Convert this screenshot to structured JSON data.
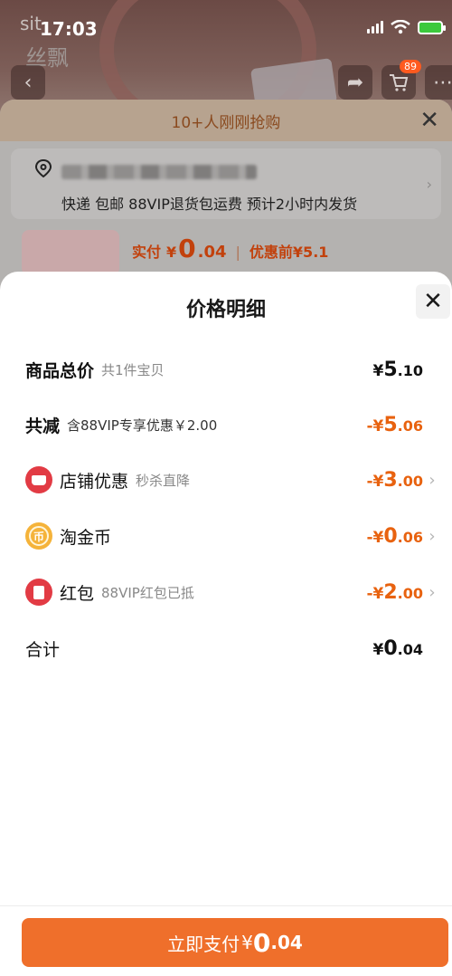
{
  "status_bar": {
    "time": "17:03",
    "watermark_latin": "sit",
    "watermark_cn": "丝飘"
  },
  "product_page": {
    "cart_badge": "89",
    "banner_text": "10+人刚刚抢购",
    "shipping_text": "快递 包邮 88VIP退货包运费 预计2小时内发货",
    "price_label": "实付",
    "price_currency": "¥",
    "price_int": "0",
    "price_dec": ".04",
    "original_label": "优惠前¥5.1"
  },
  "sheet": {
    "title": "价格明细",
    "rows": [
      {
        "name": "商品总价",
        "sub": "共1件宝贝",
        "cur": "¥",
        "int": "5",
        "dec": ".10"
      },
      {
        "name": "共减",
        "sub": "含88VIP专享优惠￥2.00",
        "cur": "-¥",
        "int": "5",
        "dec": ".06"
      },
      {
        "name": "店铺优惠",
        "sub": "秒杀直降",
        "cur": "-¥",
        "int": "3",
        "dec": ".00"
      },
      {
        "name": "淘金币",
        "sub": "",
        "cur": "-¥",
        "int": "0",
        "dec": ".06"
      },
      {
        "name": "红包",
        "sub": "88VIP红包已抵",
        "cur": "-¥",
        "int": "2",
        "dec": ".00"
      },
      {
        "name": "合计",
        "sub": "",
        "cur": "¥",
        "int": "0",
        "dec": ".04"
      }
    ],
    "coin_glyph": "币",
    "pay_button": {
      "label": "立即支付",
      "cur": "¥",
      "int": "0",
      "dec": ".04"
    }
  },
  "colors": {
    "accent": "#ef6f2b",
    "discount": "#e8620f",
    "shop_icon": "#e23b44",
    "coin_icon": "#f5b33a"
  }
}
